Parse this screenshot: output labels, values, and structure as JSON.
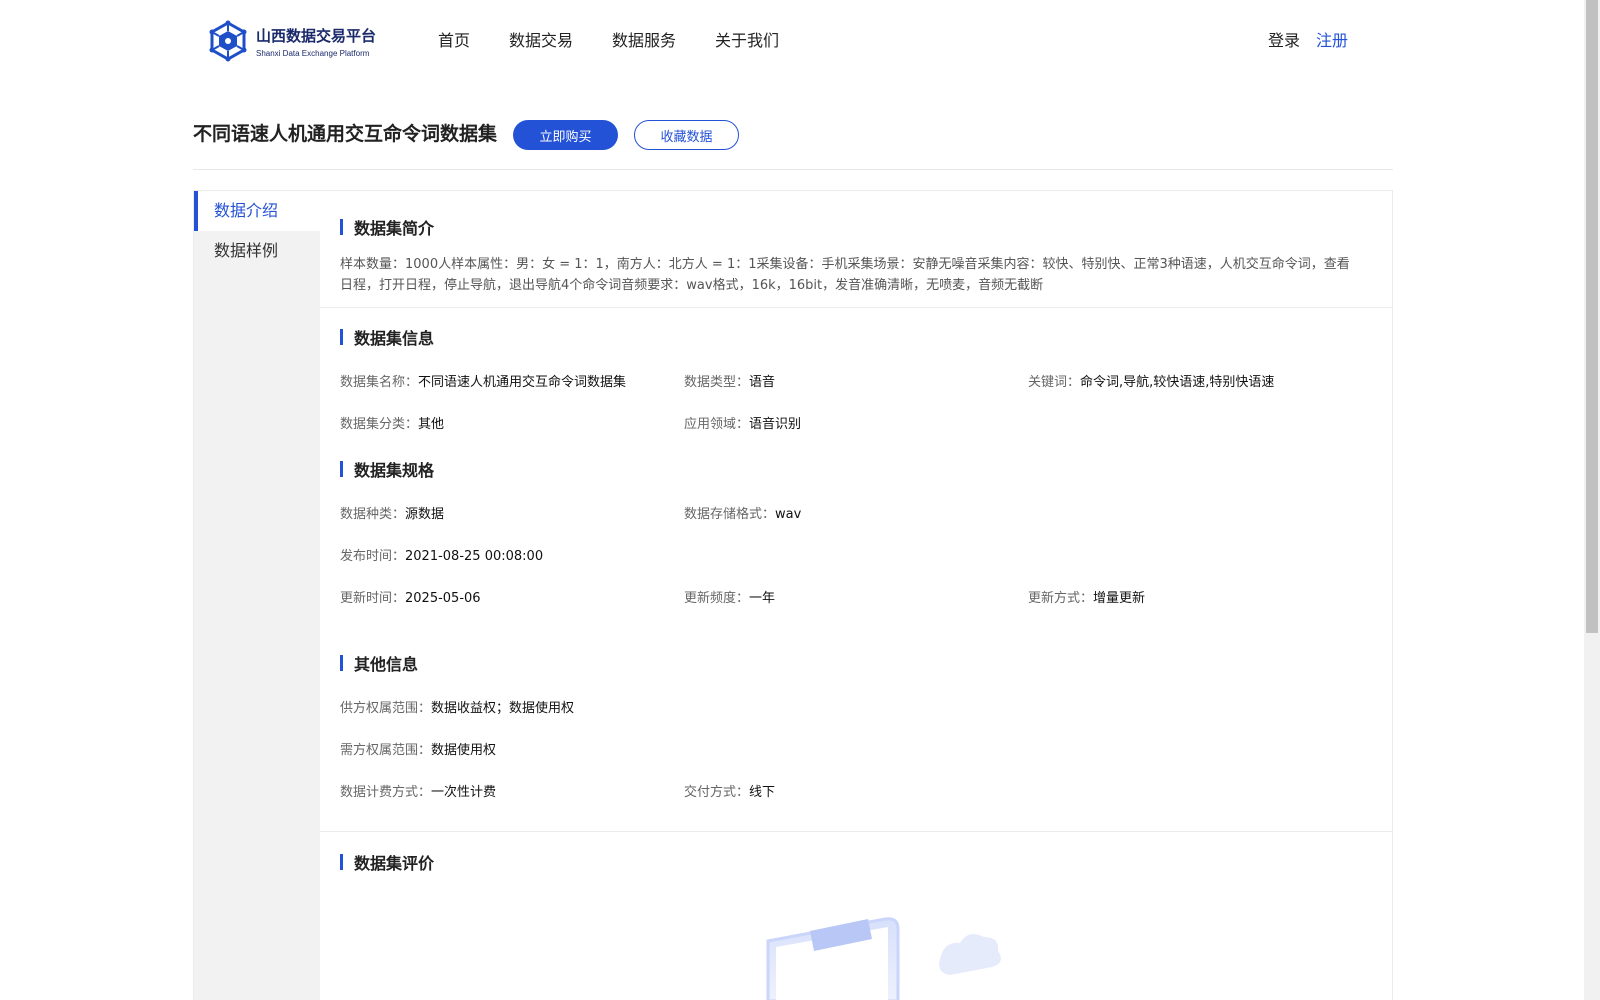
{
  "header": {
    "logo_cn": "山西数据交易平台",
    "logo_en": "Shanxi Data Exchange Platform",
    "nav": [
      "首页",
      "数据交易",
      "数据服务",
      "关于我们"
    ],
    "login": "登录",
    "register": "注册"
  },
  "title_bar": {
    "title": "不同语速人机通用交互命令词数据集",
    "buy_label": "立即购买",
    "fav_label": "收藏数据"
  },
  "sidebar": {
    "items": [
      "数据介绍",
      "数据样例"
    ],
    "active": "数据介绍"
  },
  "intro": {
    "title": "数据集简介",
    "text": "样本数量：1000人样本属性：男：女 = 1：1，南方人：北方人 = 1：1采集设备：手机采集场景：安静无噪音采集内容：较快、特别快、正常3种语速，人机交互命令词，查看日程，打开日程，停止导航，退出导航4个命令词音频要求：wav格式，16k，16bit，发音准确清晰，无喷麦，音频无截断"
  },
  "info": {
    "title": "数据集信息",
    "name_k": "数据集名称：",
    "name_v": "不同语速人机通用交互命令词数据集",
    "type_k": "数据类型：",
    "type_v": "语音",
    "keywords_k": "关键词：",
    "keywords_v": "命令词,导航,较快语速,特别快语速",
    "category_k": "数据集分类：",
    "category_v": "其他",
    "domain_k": "应用领域：",
    "domain_v": "语音识别"
  },
  "spec": {
    "title": "数据集规格",
    "kind_k": "数据种类：",
    "kind_v": "源数据",
    "format_k": "数据存储格式：",
    "format_v": "wav",
    "publish_k": "发布时间：",
    "publish_v": "2021-08-25 00:08:00",
    "update_k": "更新时间：",
    "update_v": "2025-05-06",
    "freq_k": "更新频度：",
    "freq_v": "一年",
    "method_k": "更新方式：",
    "method_v": "增量更新"
  },
  "other": {
    "title": "其他信息",
    "supply_k": "供方权属范围：",
    "supply_v": "数据收益权；数据使用权",
    "demand_k": "需方权属范围：",
    "demand_v": "数据使用权",
    "billing_k": "数据计费方式：",
    "billing_v": "一次性计费",
    "delivery_k": "交付方式：",
    "delivery_v": "线下"
  },
  "review": {
    "title": "数据集评价"
  },
  "colors": {
    "accent": "#2452d6",
    "navy": "#1b2a6b"
  },
  "icons": [
    "hexagon-network-logo-icon",
    "empty-clipboard-illustration"
  ]
}
